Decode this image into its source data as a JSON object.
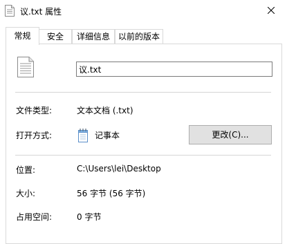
{
  "window": {
    "title": "议.txt 属性",
    "close_icon": "close-icon"
  },
  "tabs": [
    {
      "label": "常规",
      "active": true
    },
    {
      "label": "安全",
      "active": false
    },
    {
      "label": "详细信息",
      "active": false
    },
    {
      "label": "以前的版本",
      "active": false
    }
  ],
  "general": {
    "file_name": "议.txt",
    "file_type_label": "文件类型:",
    "file_type_value": "文本文档 (.txt)",
    "open_with_label": "打开方式:",
    "open_with_app": "记事本",
    "change_button": "更改(C)...",
    "location_label": "位置:",
    "location_value": "C:\\Users\\lei\\Desktop",
    "size_label": "大小:",
    "size_value": "56 字节 (56 字节)",
    "size_on_disk_label": "占用空间:",
    "size_on_disk_value": "0 字节"
  }
}
